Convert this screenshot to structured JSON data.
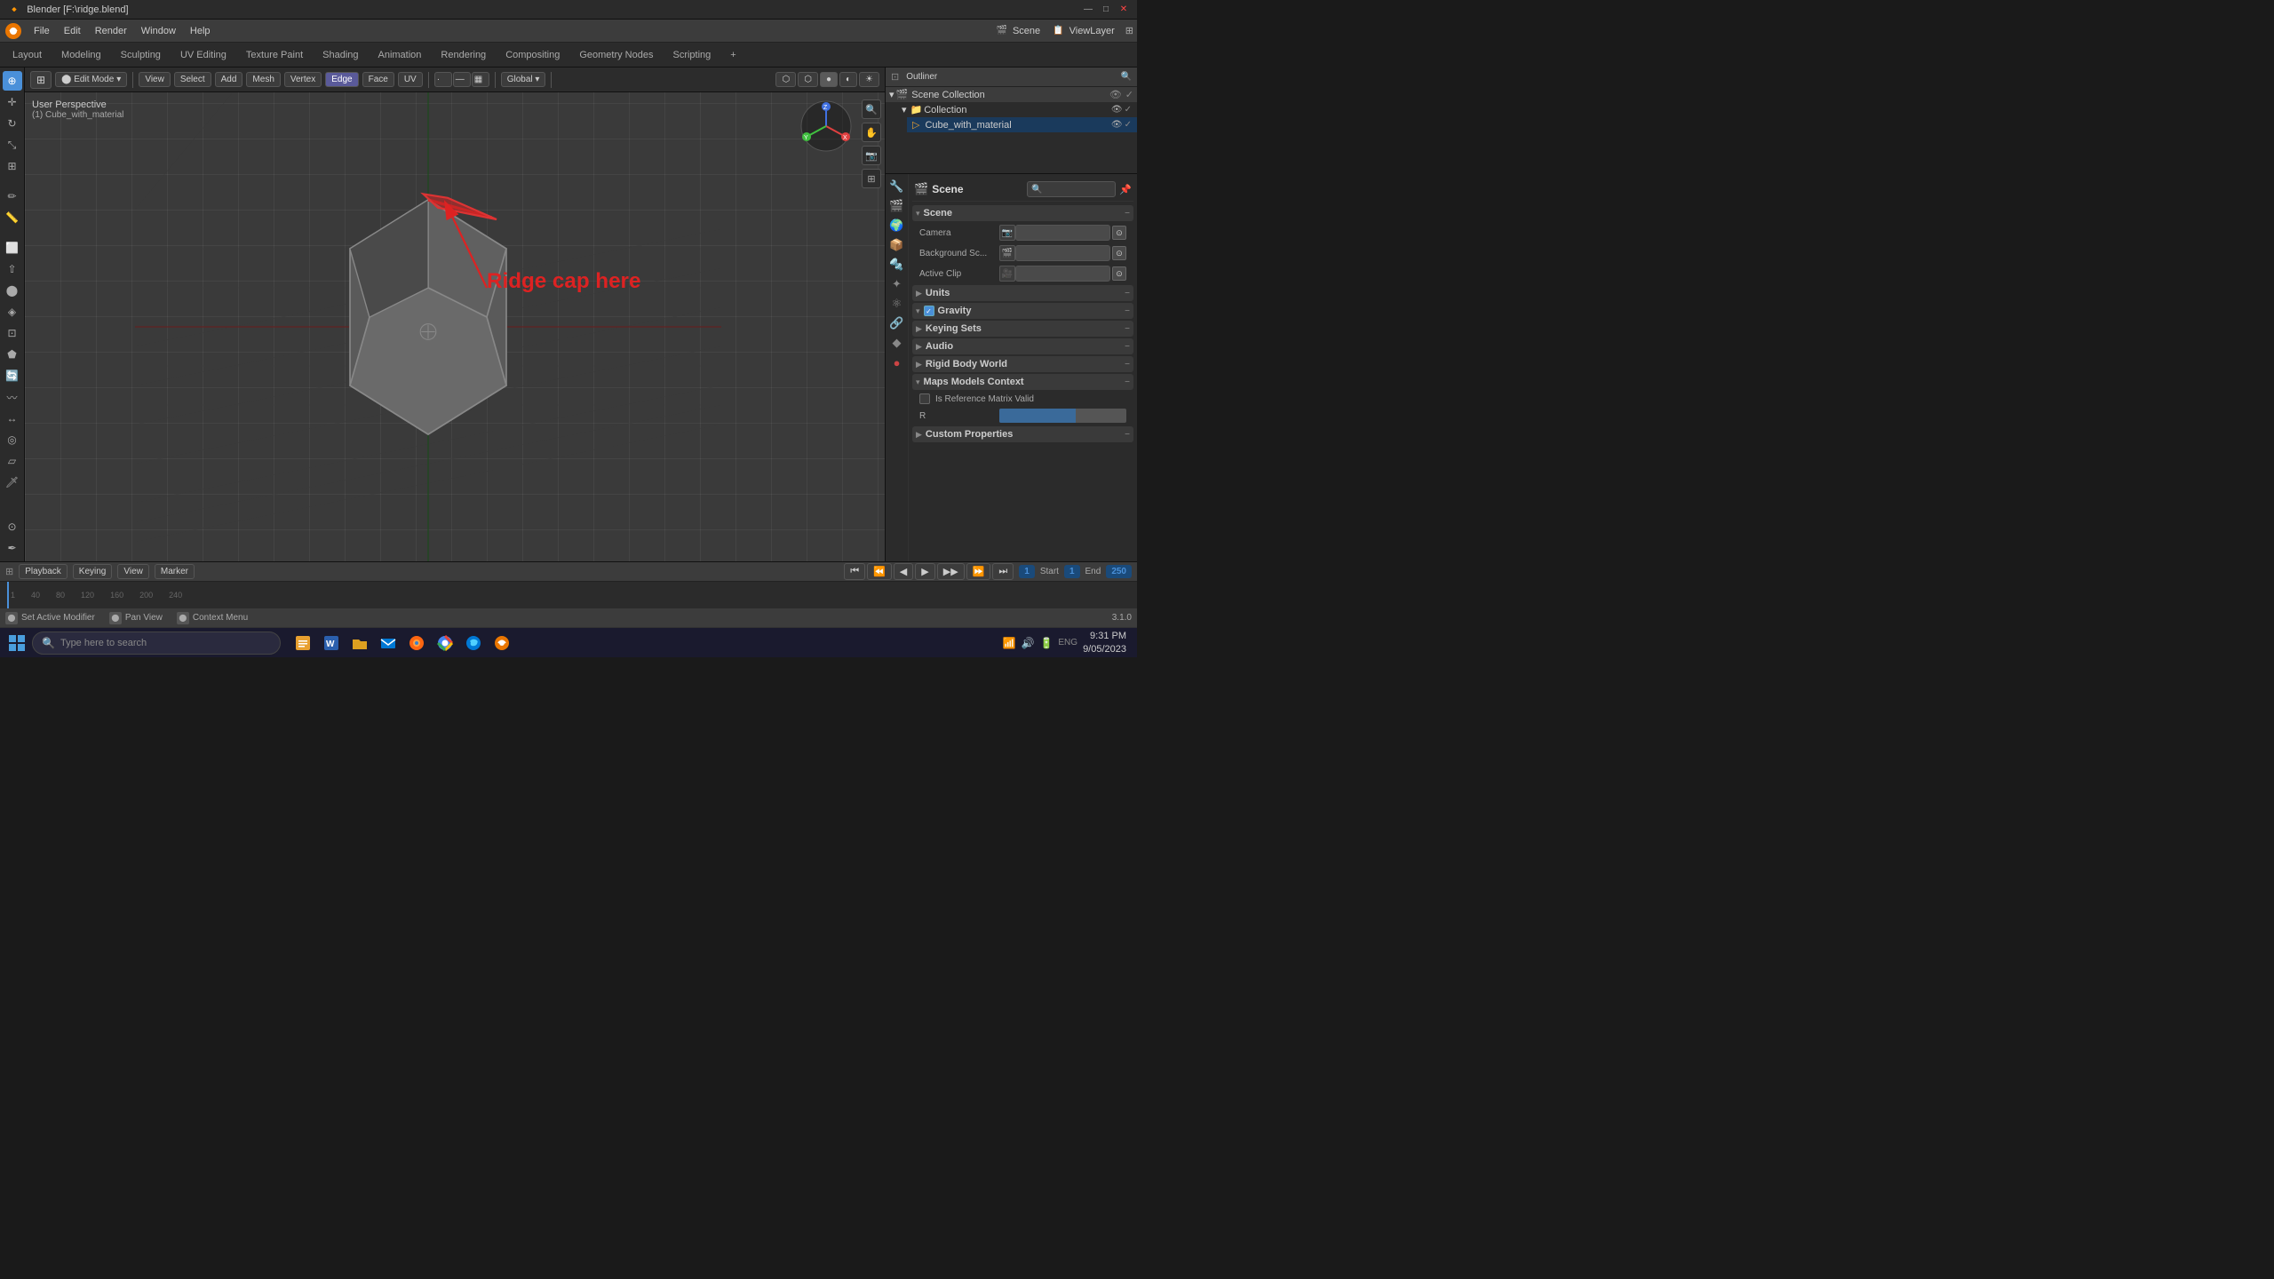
{
  "title_bar": {
    "title": "Blender [F:\\ridge.blend]",
    "minimize": "—",
    "maximize": "□",
    "close": "✕"
  },
  "menu_bar": {
    "items": [
      "Blender",
      "File",
      "Edit",
      "Render",
      "Window",
      "Help"
    ]
  },
  "workspace_tabs": {
    "tabs": [
      "Layout",
      "Modeling",
      "Sculpting",
      "UV Editing",
      "Texture Paint",
      "Shading",
      "Animation",
      "Rendering",
      "Compositing",
      "Geometry Nodes",
      "Scripting",
      "+"
    ],
    "active": "Layout"
  },
  "viewport": {
    "mode": "Edit Mode",
    "view": "User Perspective",
    "object": "(1) Cube_with_material",
    "header_items": [
      "View",
      "Select",
      "Add",
      "Mesh",
      "Vertex",
      "Edge",
      "Face",
      "UV"
    ],
    "edge_active": true,
    "annotation": "Ridge cap here",
    "transform": "Global",
    "snap": "",
    "proportional": ""
  },
  "gizmo": {
    "x_label": "X",
    "y_label": "Y",
    "z_label": "Z"
  },
  "outliner": {
    "title": "Scene Collection",
    "collection": "Collection",
    "object": "Cube_with_material"
  },
  "scene_label": "Scene",
  "properties_tabs": {
    "icons": [
      "🎬",
      "🌍",
      "📷",
      "🔧",
      "✦",
      "🔆",
      "🌊",
      "🎭",
      "📦",
      "🔲"
    ]
  },
  "scene_section": {
    "title": "Scene",
    "camera_label": "Camera",
    "background_sc_label": "Background Sc...",
    "active_clip_label": "Active Clip"
  },
  "units_section": {
    "title": "Units",
    "collapsed": true
  },
  "gravity_section": {
    "title": "Gravity",
    "checked": true
  },
  "keying_sets_section": {
    "title": "Keying Sets",
    "collapsed": true
  },
  "audio_section": {
    "title": "Audio",
    "collapsed": true
  },
  "rigid_body_world_section": {
    "title": "Rigid Body World",
    "collapsed": true
  },
  "maps_models_section": {
    "title": "Maps Models Context",
    "expanded": true,
    "is_reference_label": "Is Reference Matrix Valid",
    "r_label": "R"
  },
  "custom_properties_section": {
    "title": "Custom Properties",
    "collapsed": true
  },
  "timeline": {
    "playback": "Playback",
    "keying": "Keying",
    "view": "View",
    "marker": "Marker",
    "start_label": "Start",
    "start_value": "1",
    "end_label": "End",
    "end_value": "250",
    "current_frame": "1",
    "frame_nums": [
      "1",
      "40",
      "80",
      "120",
      "160",
      "200",
      "240"
    ]
  },
  "status_bar": {
    "modifier": "Set Active Modifier",
    "pan_view": "Pan View",
    "context_menu": "Context Menu",
    "version": "3.1.0"
  },
  "taskbar": {
    "search_placeholder": "Type here to search",
    "apps": [
      "🪟",
      "🔍",
      "💻",
      "📁",
      "✉️",
      "🦊",
      "🔵",
      "🔴"
    ],
    "time": "9:31 PM",
    "date": "9/05/2023",
    "language": "ENG"
  }
}
